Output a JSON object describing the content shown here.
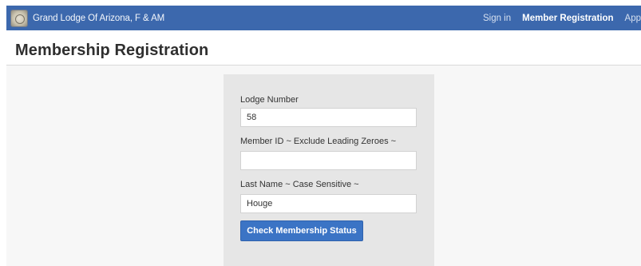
{
  "navbar": {
    "brand": "Grand Lodge Of Arizona, F & AM",
    "links": [
      {
        "label": "Sign in",
        "active": false
      },
      {
        "label": "Member Registration",
        "active": true
      },
      {
        "label": "App",
        "active": false
      }
    ],
    "color": "#3c68ad"
  },
  "header": {
    "title": "Membership Registration"
  },
  "form": {
    "lodge_number": {
      "label": "Lodge Number",
      "value": "58"
    },
    "member_id": {
      "label": "Member ID ~ Exclude Leading Zeroes ~",
      "value": ""
    },
    "last_name": {
      "label": "Last Name ~ Case Sensitive ~",
      "value": "Houge"
    },
    "submit_label": "Check Membership Status",
    "button_color": "#3b74c5"
  }
}
